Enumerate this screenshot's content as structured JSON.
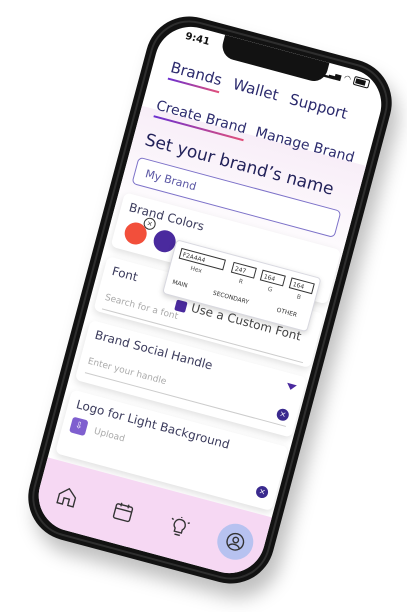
{
  "status": {
    "time": "9:41"
  },
  "top_tabs": [
    "Brands",
    "Wallet",
    "Support"
  ],
  "sub_tabs": [
    "Create Brand",
    "Manage Brand"
  ],
  "section_title": "Set your brand’s name",
  "brand_name": {
    "value": "My Brand"
  },
  "brand_colors": {
    "label": "Brand Colors",
    "swatches": [
      "#f24f3b",
      "#4a2a9e"
    ],
    "picker": {
      "hex_value": "F2A4A4",
      "r_value": "247",
      "g_value": "164",
      "b_value": "164",
      "labels": [
        "Hex",
        "R",
        "G",
        "B"
      ],
      "tabs": [
        "MAIN",
        "SECONDARY",
        "OTHER"
      ]
    }
  },
  "font": {
    "label": "Font",
    "custom_font_label": "Use a Custom Font",
    "placeholder": "Search for a font"
  },
  "social": {
    "label": "Brand Social Handle",
    "placeholder": "Enter your handle"
  },
  "logo": {
    "label": "Logo for Light Background",
    "upload_label": "Upload"
  },
  "nav": [
    "home-icon",
    "calendar-icon",
    "lightbulb-icon",
    "profile-icon"
  ],
  "colors": {
    "accent": "#4a2a9e",
    "nav_bg": "#f6d8f3"
  }
}
